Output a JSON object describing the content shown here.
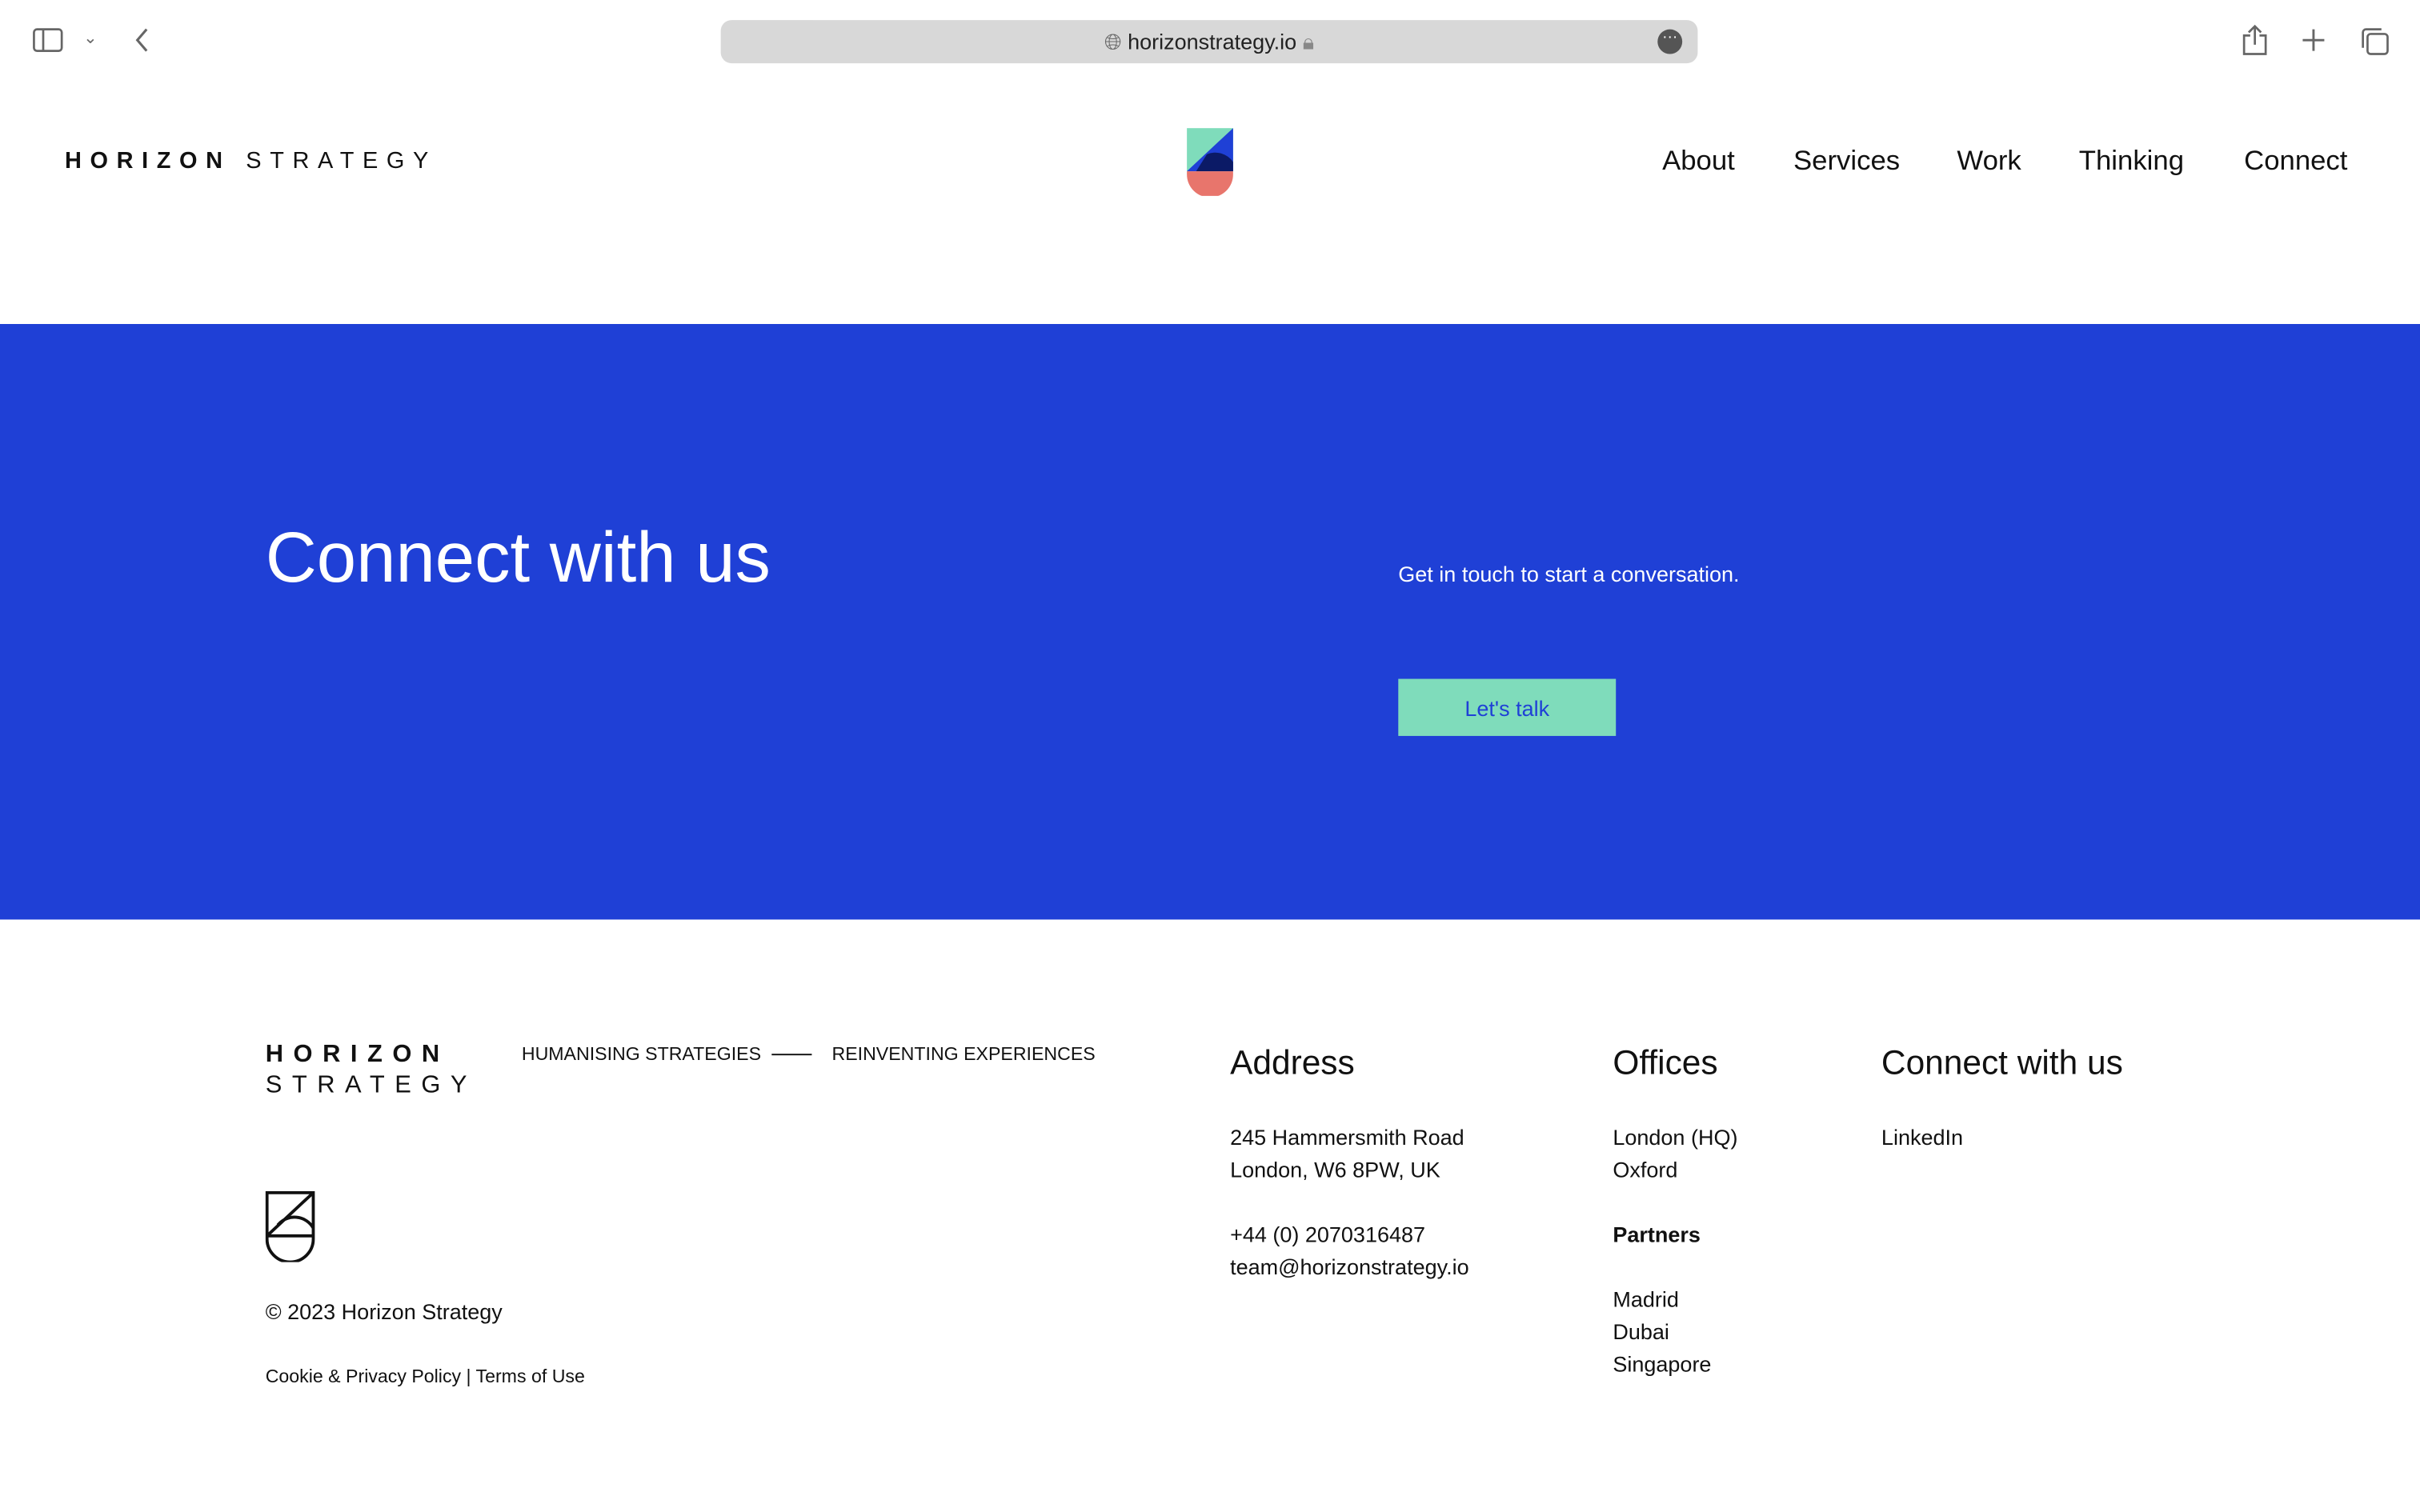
{
  "browser": {
    "url": "horizonstrategy.io"
  },
  "header": {
    "logo_bold": "HORIZON",
    "logo_light": "STRATEGY",
    "nav": [
      "About",
      "Services",
      "Work",
      "Thinking",
      "Connect"
    ]
  },
  "hero": {
    "title": "Connect with us",
    "subtitle": "Get in touch to start a conversation.",
    "cta": "Let's talk",
    "background": "#1f40d6",
    "cta_color": "#7fdcbb"
  },
  "footer": {
    "logo_bold": "HORIZON",
    "logo_light": "STRATEGY",
    "tagline_left": "HUMANISING STRATEGIES",
    "tagline_right": "REINVENTING EXPERIENCES",
    "copyright": "© 2023 Horizon Strategy",
    "legal": "Cookie & Privacy Policy | Terms of Use",
    "address": {
      "heading": "Address",
      "line1": "245 Hammersmith Road",
      "line2": "London, W6 8PW, UK",
      "phone": "+44 (0) 2070316487",
      "email": "team@horizonstrategy.io"
    },
    "offices": {
      "heading": "Offices",
      "items": [
        "London (HQ)",
        "Oxford"
      ],
      "partners_heading": "Partners",
      "partners": [
        "Madrid",
        "Dubai",
        "Singapore"
      ]
    },
    "connect": {
      "heading": "Connect with us",
      "linkedin": "LinkedIn"
    }
  }
}
